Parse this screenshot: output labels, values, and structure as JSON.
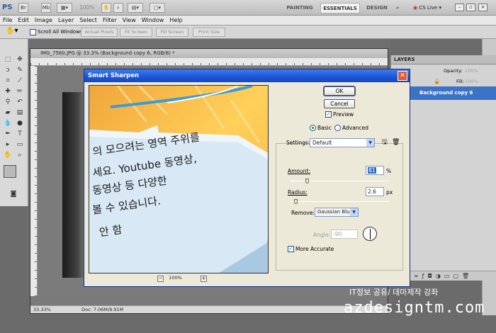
{
  "app": {
    "logo": "PS",
    "zoom": "100%",
    "workspaces": [
      "PAINTING",
      "ESSENTIALS",
      "DESIGN"
    ],
    "active_workspace": "ESSENTIALS",
    "cs_live": "CS Live"
  },
  "menu": [
    "File",
    "Edit",
    "Image",
    "Layer",
    "Select",
    "Filter",
    "View",
    "Window",
    "Help"
  ],
  "options_bar": {
    "scroll_all_windows": "Scroll All Windows",
    "buttons": [
      "Actual Pixels",
      "Fit Screen",
      "Fill Screen",
      "Print Size"
    ]
  },
  "document": {
    "title": "IMG_7560.JPG @ 33.3% (Background copy 6, RGB/8) *",
    "zoom": "33.33%",
    "doc_size": "Doc: 7.06M/8.91M"
  },
  "layers_panel": {
    "tab": "LAYERS",
    "opacity_label": "Opacity:",
    "opacity_value": "100%",
    "fill_label": "Fill:",
    "fill_value": "100%",
    "active_layer": "Background copy 6"
  },
  "dialog": {
    "title": "Smart Sharpen",
    "ok": "OK",
    "cancel": "Cancel",
    "preview_label": "Preview",
    "preview_checked": true,
    "mode_basic": "Basic",
    "mode_advanced": "Advanced",
    "mode_selected": "Basic",
    "settings_label": "Settings:",
    "settings_value": "Default",
    "amount_label": "Amount:",
    "amount_value": "81",
    "amount_unit": "%",
    "amount_level": 0.16,
    "radius_label": "Radius:",
    "radius_value": "2.6",
    "radius_unit": "px",
    "radius_level": 0.04,
    "remove_label": "Remove:",
    "remove_value": "Gaussian Blur",
    "angle_label": "Angle:",
    "angle_value": "-90",
    "more_accurate_label": "More Accurate",
    "more_accurate_checked": true,
    "preview_zoom": "100%",
    "preview_text_lines": [
      "의 모으려는 영역 주위를",
      "세요. Youtube 동영상,",
      "동영상 등 다양한",
      "볼 수 있습니다.",
      "안 함"
    ]
  },
  "watermark": {
    "line1": "IT정보 공유/ 데마제작 강좌",
    "line2": "azdesigntm.com"
  }
}
